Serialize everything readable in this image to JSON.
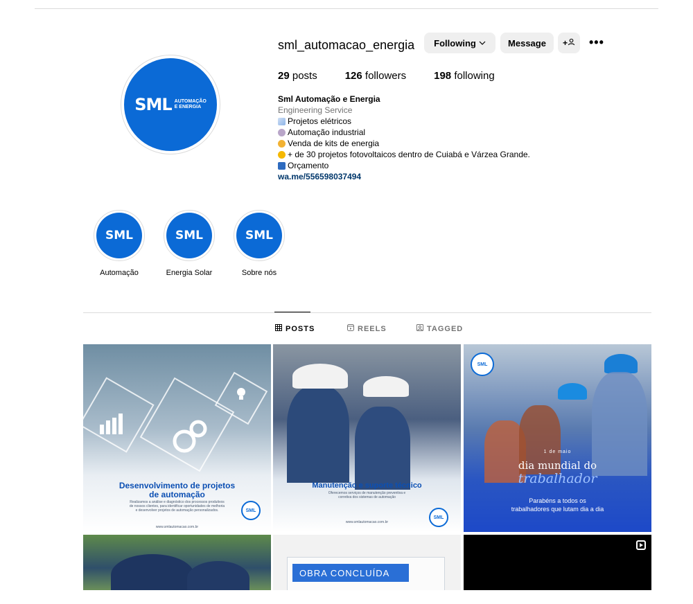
{
  "profile": {
    "username": "sml_automacao_energia",
    "avatar_mark": "SML",
    "avatar_text_line1": "AUTOMAÇÃO",
    "avatar_text_line2": "E ENERGIA"
  },
  "actions": {
    "following_label": "Following",
    "message_label": "Message",
    "add_user_label": "+",
    "more_label": "•••"
  },
  "stats": {
    "posts_count": "29",
    "posts_label": "posts",
    "followers_count": "126",
    "followers_label": "followers",
    "following_count": "198",
    "following_label": "following"
  },
  "bio": {
    "name": "Sml Automação e Energia",
    "category": "Engineering Service",
    "lines": [
      "Projetos elétricos",
      "Automação industrial",
      " Venda de kits de energia",
      "+ de 30 projetos fotovoltaicos dentro de Cuiabá e Várzea Grande.",
      "Orçamento"
    ],
    "link": "wa.me/556598037494"
  },
  "highlights": [
    {
      "label": "Automação",
      "mark": "SML"
    },
    {
      "label": "Energia Solar",
      "mark": "SML"
    },
    {
      "label": "Sobre nós",
      "mark": "SML"
    }
  ],
  "tabs": [
    {
      "label": "POSTS",
      "icon": "grid-icon",
      "active": true
    },
    {
      "label": "REELS",
      "icon": "reels-icon",
      "active": false
    },
    {
      "label": "TAGGED",
      "icon": "tagged-icon",
      "active": false
    }
  ],
  "posts": {
    "p1": {
      "title_line1": "Desenvolvimento de projetos",
      "title_line2": "de automação",
      "sub_line1": "Realizamos a análise e diagnóstico dos processos produtivos",
      "sub_line2": "de nossos clientes, para identificar oportunidades de melhoria",
      "sub_line3": "e desenvolver projetos de automação personalizados.",
      "url": "www.smlautomacao.com.br"
    },
    "p2": {
      "title": "Manutenção e suporte técnico",
      "sub_line1": "Oferecemos serviços de manutenção preventiva e",
      "sub_line2": "corretiva dos sistemas de automação",
      "url": "www.smlautomacao.com.br"
    },
    "p3": {
      "small": "1 de maio",
      "title": "dia mundial do",
      "script": "trabalhador",
      "sub_line1": "Parabéns a todos os",
      "sub_line2": "trabalhadores que lutam dia a dia"
    },
    "p5": {
      "title": "OBRA CONCLUÍDA"
    }
  },
  "colors": {
    "brand_blue": "#0b6ad6",
    "link": "#00376b",
    "muted": "#737373",
    "button_bg": "#efefef"
  }
}
